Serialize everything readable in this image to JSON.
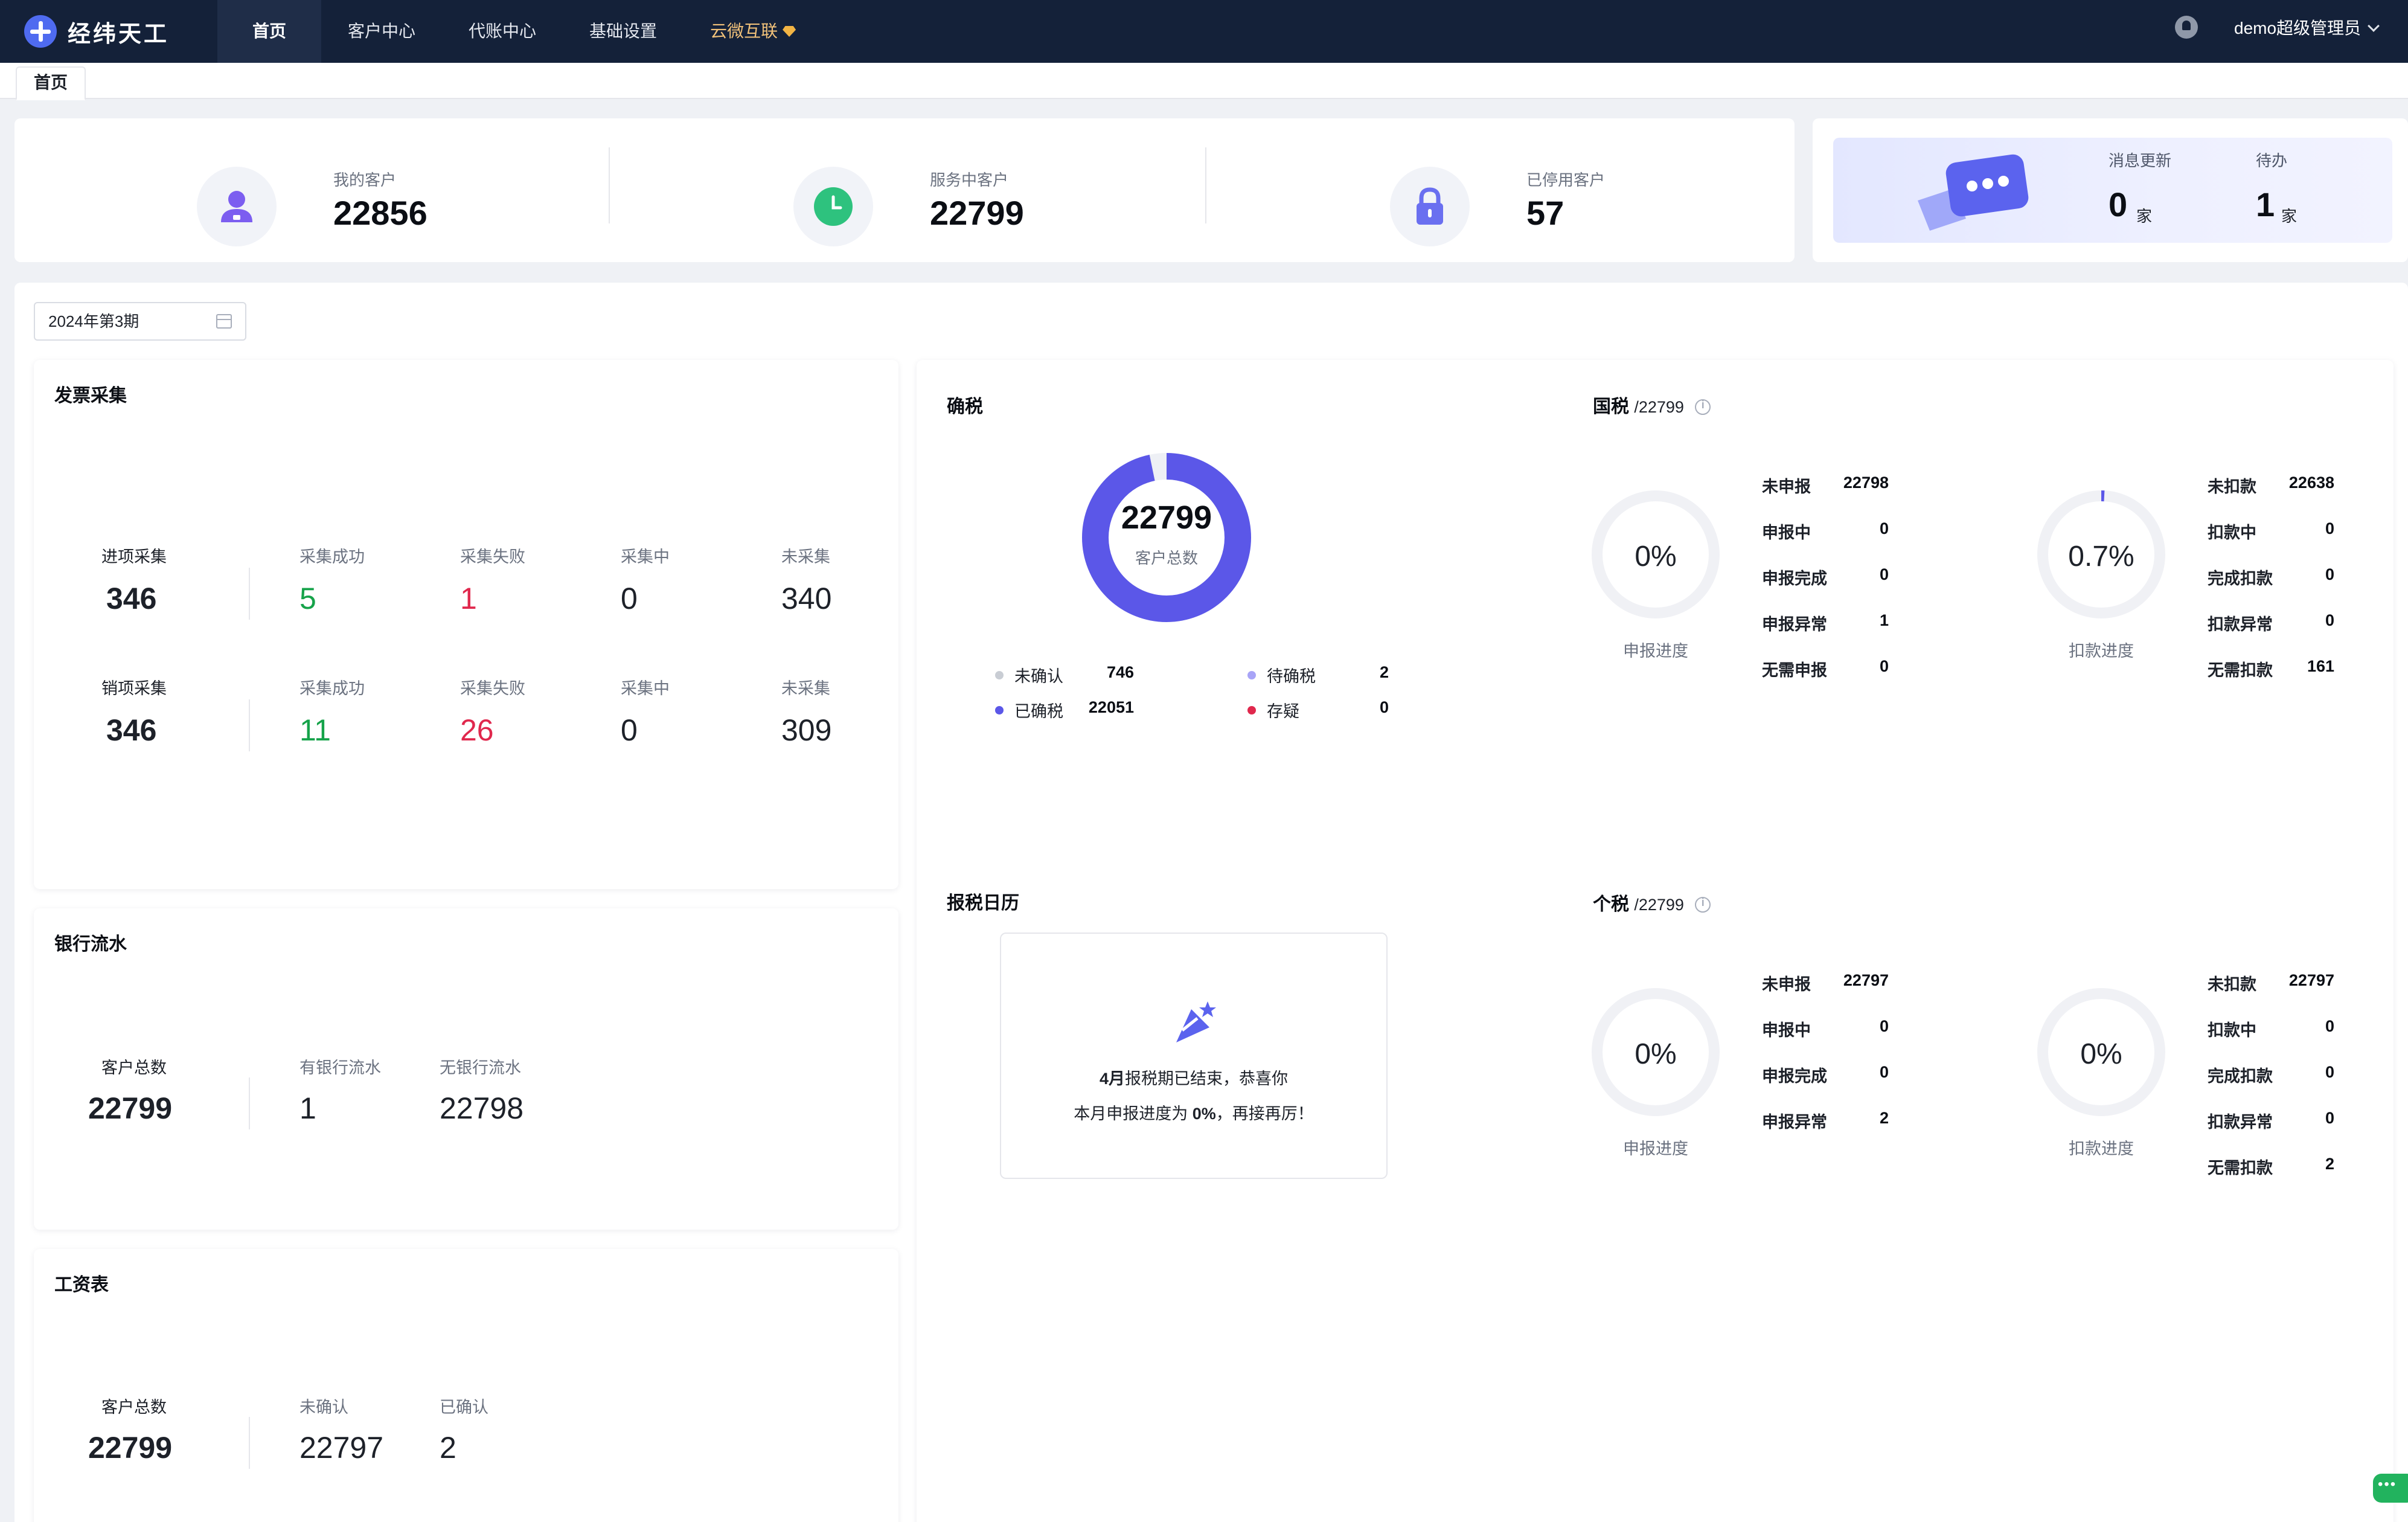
{
  "app": {
    "brand": "经纬天工",
    "user": "demo超级管理员"
  },
  "nav": [
    {
      "label": "首页",
      "active": true
    },
    {
      "label": "客户中心"
    },
    {
      "label": "代账中心"
    },
    {
      "label": "基础设置"
    },
    {
      "label": "云微互联",
      "premium": true
    }
  ],
  "tabs": [
    "首页"
  ],
  "summary": {
    "my_customers": {
      "label": "我的客户",
      "value": "22856"
    },
    "serving": {
      "label": "服务中客户",
      "value": "22799"
    },
    "disabled": {
      "label": "已停用客户",
      "value": "57"
    }
  },
  "messages": {
    "updates_label": "消息更新",
    "updates_value": "0",
    "updates_unit": "家",
    "todo_label": "待办",
    "todo_value": "1",
    "todo_unit": "家"
  },
  "period": {
    "value": "2024年第3期"
  },
  "invoice": {
    "title": "发票采集",
    "rows": [
      {
        "name": "进项采集",
        "total": "346",
        "success_label": "采集成功",
        "success": "5",
        "fail_label": "采集失败",
        "fail": "1",
        "doing_label": "采集中",
        "doing": "0",
        "none_label": "未采集",
        "none": "340"
      },
      {
        "name": "销项采集",
        "total": "346",
        "success_label": "采集成功",
        "success": "11",
        "fail_label": "采集失败",
        "fail": "26",
        "doing_label": "采集中",
        "doing": "0",
        "none_label": "未采集",
        "none": "309"
      }
    ]
  },
  "bank": {
    "title": "银行流水",
    "total_label": "客户总数",
    "total": "22799",
    "has_label": "有银行流水",
    "has": "1",
    "none_label": "无银行流水",
    "none": "22798"
  },
  "payroll": {
    "title": "工资表",
    "total_label": "客户总数",
    "total": "22799",
    "unconfirmed_label": "未确认",
    "unconfirmed": "22797",
    "confirmed_label": "已确认",
    "confirmed": "2"
  },
  "confirm_tax": {
    "title": "确税",
    "center_value": "22799",
    "center_label": "客户总数",
    "legend": [
      {
        "label": "未确认",
        "value": "746",
        "color": "#c9cdd4"
      },
      {
        "label": "待确税",
        "value": "2",
        "color": "#a8a4f7"
      },
      {
        "label": "已确税",
        "value": "22051",
        "color": "#5b57e8"
      },
      {
        "label": "存疑",
        "value": "0",
        "color": "#e0284d"
      }
    ]
  },
  "national_tax": {
    "title": "国税",
    "suffix": "/22799",
    "declare": {
      "percent": "0%",
      "caption": "申报进度",
      "fill": 0.0
    },
    "deduct": {
      "percent": "0.7%",
      "caption": "扣款进度",
      "fill": 0.007
    },
    "declare_items": [
      {
        "label": "未申报",
        "value": "22798"
      },
      {
        "label": "申报中",
        "value": "0"
      },
      {
        "label": "申报完成",
        "value": "0"
      },
      {
        "label": "申报异常",
        "value": "1"
      },
      {
        "label": "无需申报",
        "value": "0"
      }
    ],
    "deduct_items": [
      {
        "label": "未扣款",
        "value": "22638"
      },
      {
        "label": "扣款中",
        "value": "0"
      },
      {
        "label": "完成扣款",
        "value": "0"
      },
      {
        "label": "扣款异常",
        "value": "0"
      },
      {
        "label": "无需扣款",
        "value": "161"
      }
    ]
  },
  "calendar": {
    "title": "报税日历",
    "line1_prefix": "4月",
    "line1_rest": "报税期已结束，恭喜你",
    "line2_prefix": "本月申报进度为 ",
    "line2_pct": "0%",
    "line2_rest": "，再接再厉！"
  },
  "personal_tax": {
    "title": "个税",
    "suffix": "/22799",
    "declare": {
      "percent": "0%",
      "caption": "申报进度",
      "fill": 0.0
    },
    "deduct": {
      "percent": "0%",
      "caption": "扣款进度",
      "fill": 0.0
    },
    "declare_items": [
      {
        "label": "未申报",
        "value": "22797"
      },
      {
        "label": "申报中",
        "value": "0"
      },
      {
        "label": "申报完成",
        "value": "0"
      },
      {
        "label": "申报异常",
        "value": "2"
      }
    ],
    "deduct_items": [
      {
        "label": "未扣款",
        "value": "22797"
      },
      {
        "label": "扣款中",
        "value": "0"
      },
      {
        "label": "完成扣款",
        "value": "0"
      },
      {
        "label": "扣款异常",
        "value": "0"
      },
      {
        "label": "无需扣款",
        "value": "2"
      }
    ]
  },
  "colors": {
    "nav_bg": "#142139",
    "accent": "#5b57e8",
    "success": "#16a34a",
    "danger": "#e0284d"
  }
}
